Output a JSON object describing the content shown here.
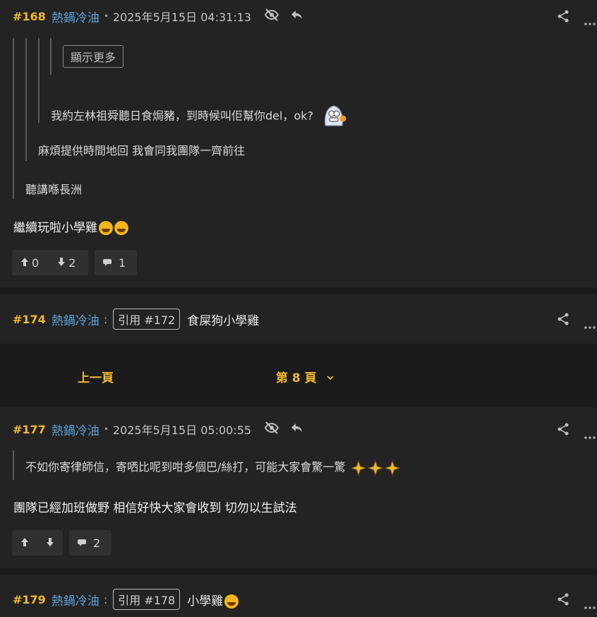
{
  "posts": {
    "p168": {
      "num": "#168",
      "user": "熱鍋冷油",
      "time": "2025年5月15日 04:31:13",
      "show_more": "顯示更多",
      "quote3": "我約左林祖舜聽日食焗豬，到時候叫佢幫你del，ok?",
      "quote2": "麻煩提供時間地回 我會同我團隊一齊前往",
      "quote1": "聽講喺長洲",
      "body": "繼續玩啦小學雞",
      "up": "0",
      "down": "2",
      "replies": "1"
    },
    "p174": {
      "num": "#174",
      "user": "熱鍋冷油",
      "quote_label": "引用 #172",
      "text": "食屎狗小學雞"
    },
    "pager": {
      "prev": "上一頁",
      "current": "第 8 頁"
    },
    "p177": {
      "num": "#177",
      "user": "熱鍋冷油",
      "time": "2025年5月15日 05:00:55",
      "quote1": "不如你寄律師信，寄哂比呢到咁多個巴/絲打，可能大家會驚一驚",
      "body": "團隊已經加班做野 相信好快大家會收到 切勿以生試法",
      "replies": "2"
    },
    "p179": {
      "num": "#179",
      "user": "熱鍋冷油",
      "quote_label": "引用 #178",
      "text": "小學雞"
    }
  },
  "icons": {
    "hide": "eye-off-icon",
    "reply": "reply-icon",
    "share": "share-icon",
    "more": "more-icon",
    "up": "arrow-up-icon",
    "down": "arrow-down-icon",
    "comment": "comment-icon"
  },
  "colors": {
    "post_number": "#f0b832",
    "username": "#5ea0d6",
    "background": "#232323"
  }
}
